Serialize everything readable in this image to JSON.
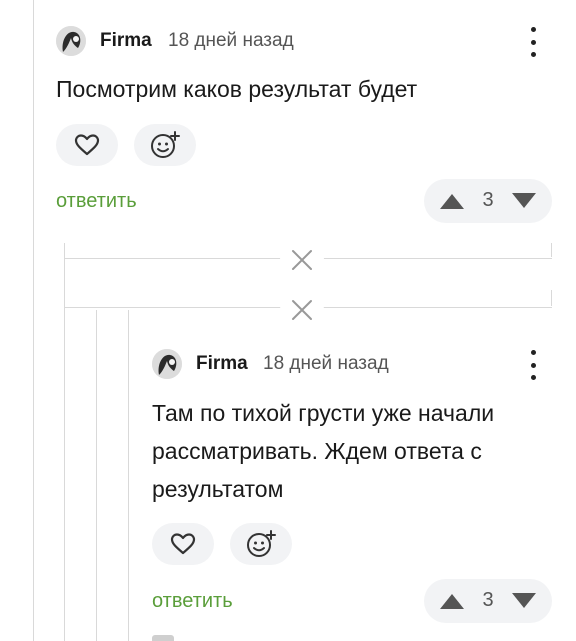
{
  "comments": [
    {
      "author": "Firma",
      "time": "18 дней назад",
      "text": "Посмотрим каков результат будет",
      "reply_label": "ответить",
      "score": "3"
    },
    {
      "author": "Firma",
      "time": "18 дней назад",
      "text": "Там по тихой грусти уже начали рассматривать. Ждем ответа с результатом",
      "reply_label": "ответить",
      "score": "3"
    }
  ],
  "colors": {
    "reply": "#5a9e3a",
    "pill_bg": "#f2f3f5",
    "thread_line": "#d9d9d9"
  },
  "icons": [
    "more-vertical-icon",
    "heart-icon",
    "add-emoji-icon",
    "arrow-up-icon",
    "arrow-down-icon",
    "close-icon"
  ]
}
